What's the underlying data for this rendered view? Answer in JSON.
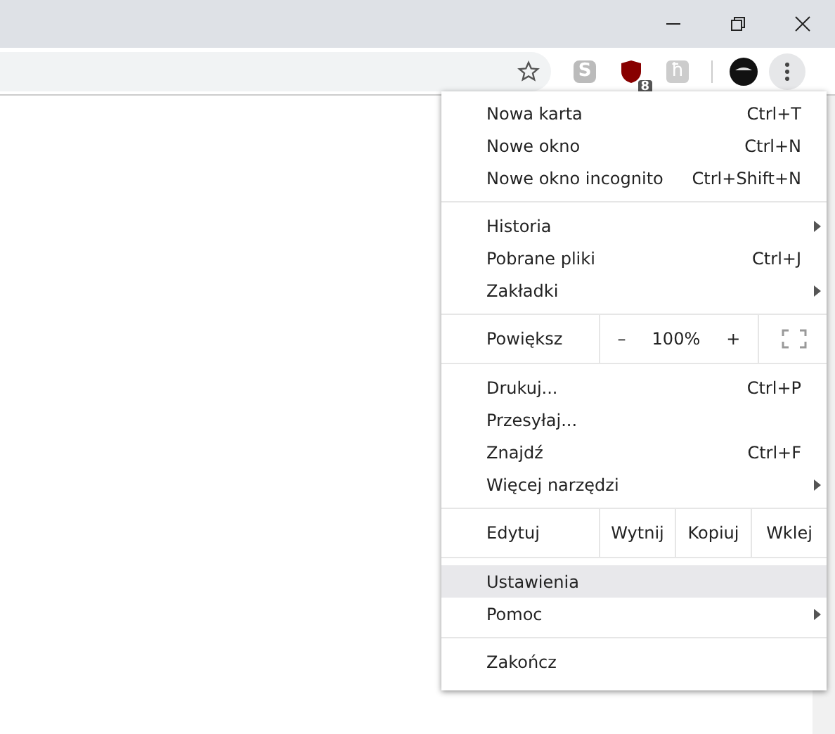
{
  "extensions": [
    {
      "kind": "letter",
      "text": "S"
    },
    {
      "kind": "shield",
      "badge": "8"
    },
    {
      "kind": "glyph",
      "text": "ħ"
    }
  ],
  "menu": [
    {
      "kind": "items",
      "items": [
        {
          "label": "Nowa karta",
          "shortcut": "Ctrl+T",
          "submenu": false,
          "selected": false
        },
        {
          "label": "Nowe okno",
          "shortcut": "Ctrl+N",
          "submenu": false,
          "selected": false
        },
        {
          "label": "Nowe okno incognito",
          "shortcut": "Ctrl+Shift+N",
          "submenu": false,
          "selected": false
        }
      ]
    },
    {
      "kind": "items",
      "items": [
        {
          "label": "Historia",
          "submenu": true,
          "selected": false
        },
        {
          "label": "Pobrane pliki",
          "shortcut": "Ctrl+J",
          "submenu": false,
          "selected": false
        },
        {
          "label": "Zakładki",
          "submenu": true,
          "selected": false
        }
      ]
    },
    {
      "kind": "zoom",
      "label": "Powiększ",
      "minus": "–",
      "value": "100%",
      "plus": "+"
    },
    {
      "kind": "items",
      "items": [
        {
          "label": "Drukuj...",
          "shortcut": "Ctrl+P",
          "submenu": false,
          "selected": false
        },
        {
          "label": "Przesyłaj...",
          "submenu": false,
          "selected": false
        },
        {
          "label": "Znajdź",
          "shortcut": "Ctrl+F",
          "submenu": false,
          "selected": false
        },
        {
          "label": "Więcej narzędzi",
          "submenu": true,
          "selected": false
        }
      ]
    },
    {
      "kind": "edit",
      "label": "Edytuj",
      "buttons": [
        "Wytnij",
        "Kopiuj",
        "Wklej"
      ]
    },
    {
      "kind": "items",
      "items": [
        {
          "label": "Ustawienia",
          "submenu": false,
          "selected": true
        },
        {
          "label": "Pomoc",
          "submenu": true,
          "selected": false
        }
      ]
    },
    {
      "kind": "items",
      "items": [
        {
          "label": "Zakończ",
          "submenu": false,
          "selected": false
        }
      ]
    }
  ]
}
